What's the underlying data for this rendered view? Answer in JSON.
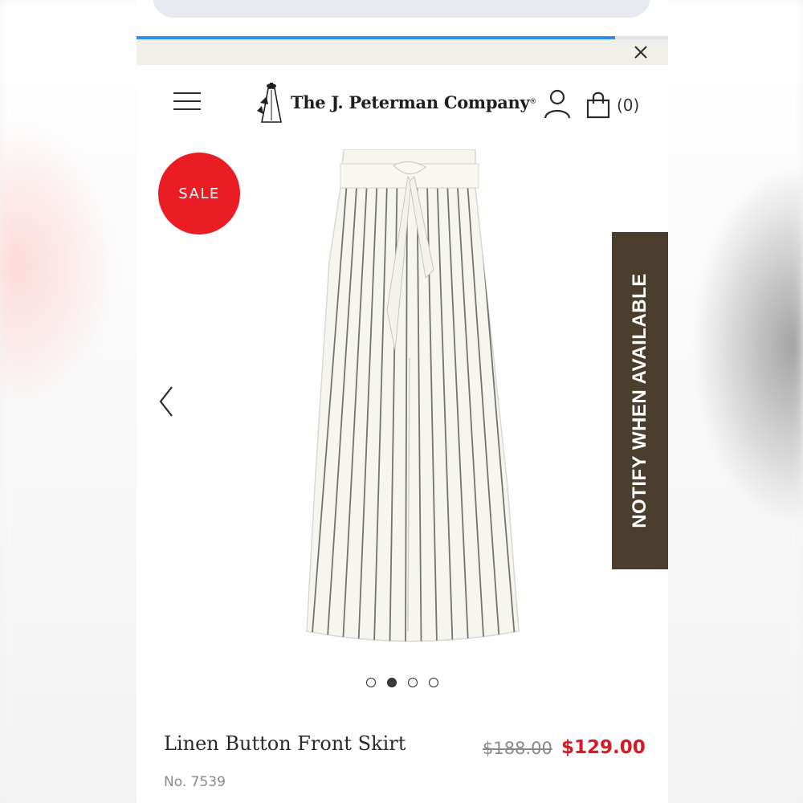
{
  "colors": {
    "sale_badge": "#ea1c24",
    "notify_bg": "#4a3e2e",
    "price_red": "#d81922",
    "progress": "#2f8fe6",
    "banner_bg": "#f1efea"
  },
  "browser": {
    "page_load_progress": 0.9
  },
  "banner": {
    "close_icon": "close-icon"
  },
  "header": {
    "menu_icon": "hamburger-menu-icon",
    "brand": "The J. Peterman Company",
    "brand_mark": "®",
    "account_icon": "user-icon",
    "cart_icon": "shopping-bag-icon",
    "cart_count": "(0)"
  },
  "gallery": {
    "badge": "SALE",
    "prev_icon": "chevron-left-icon",
    "notify_label": "NOTIFY WHEN AVAILABLE",
    "image_count": 4,
    "active_index": 1
  },
  "product": {
    "title": "Linen Button Front Skirt",
    "original_price": "$188.00",
    "sale_price": "$129.00",
    "item_number": "No. 7539"
  }
}
